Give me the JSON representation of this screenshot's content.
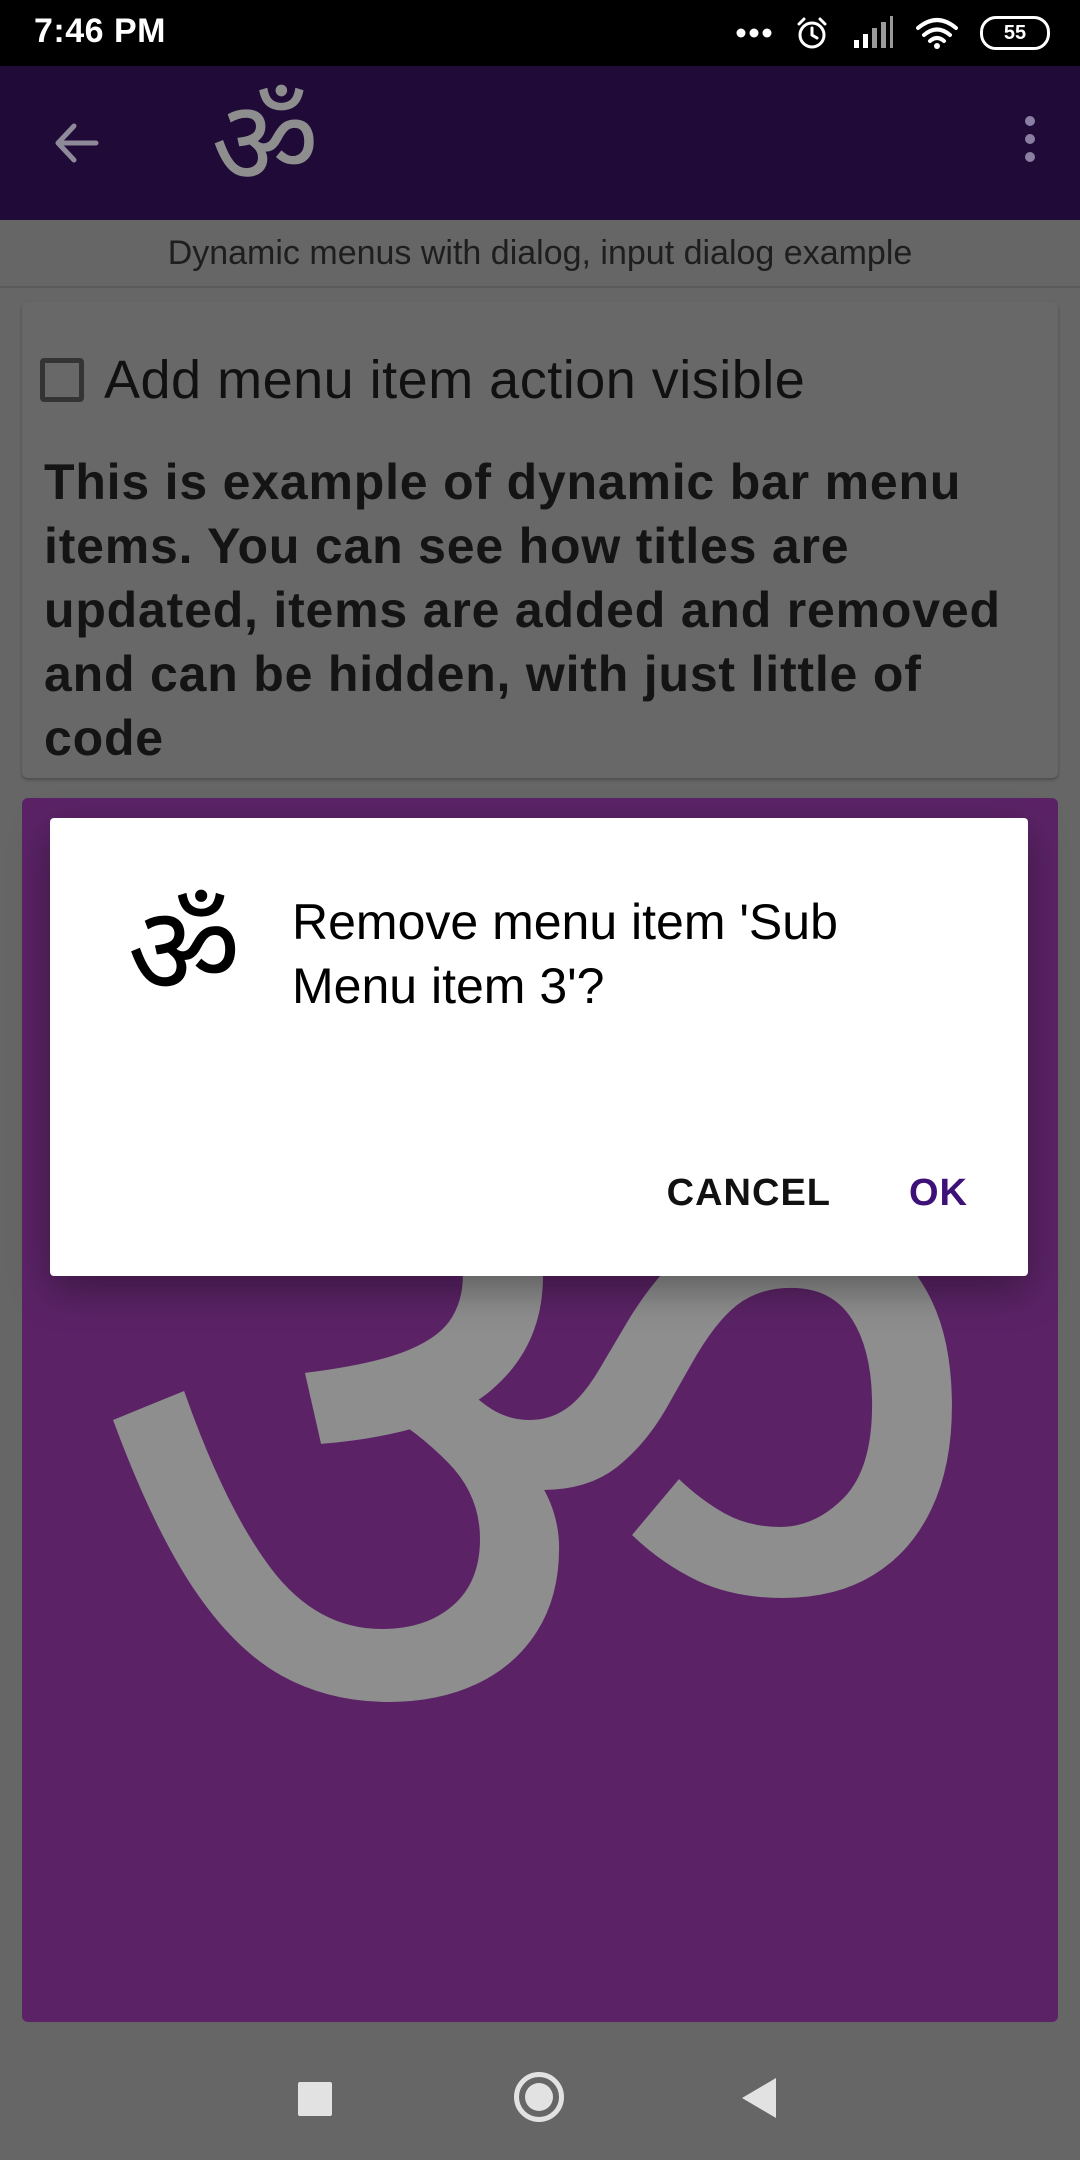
{
  "status_bar": {
    "time": "7:46 PM",
    "battery": "55",
    "icons": [
      "more-dots-icon",
      "alarm-icon",
      "signal-icon",
      "wifi-icon",
      "battery-icon"
    ]
  },
  "app_bar": {
    "logo_glyph": "ॐ",
    "icons": [
      "back-arrow-icon",
      "om-logo-icon",
      "overflow-menu-icon"
    ],
    "background": "#1f0a38"
  },
  "subtitle": "Dynamic menus with dialog, input dialog example",
  "content": {
    "checkbox_label": "Add menu item action visible",
    "checkbox_checked": false,
    "description": "This is example of dynamic bar menu items. You can see how titles are updated, items are added and removed and can be hidden, with just little of code"
  },
  "image_card": {
    "glyph": "ॐ",
    "background": "#5b2366",
    "glyph_color": "#8e8e8e"
  },
  "dialog": {
    "icon_glyph": "ॐ",
    "title": "Remove menu item 'Sub Menu item 3'?",
    "cancel_label": "CANCEL",
    "ok_label": "OK",
    "accent": "#3d1178"
  },
  "nav_bar": {
    "icons": [
      "recents-icon",
      "home-icon",
      "back-icon"
    ]
  }
}
